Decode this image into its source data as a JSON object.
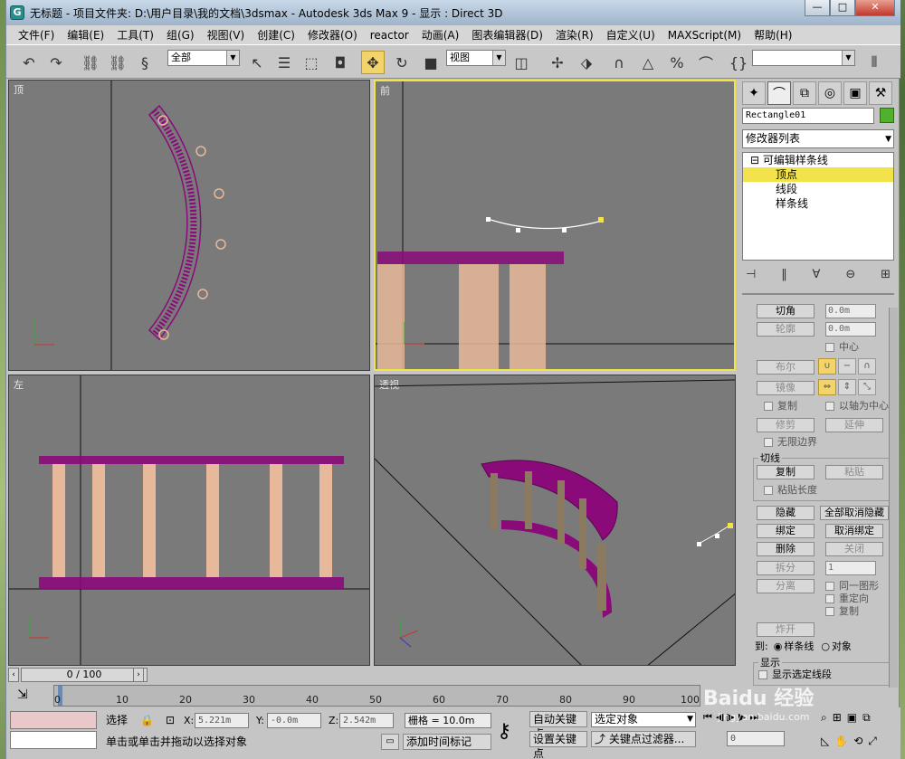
{
  "window": {
    "icon_label": "G",
    "title": "无标题    - 项目文件夹: D:\\用户目录\\我的文档\\3dsmax      - Autodesk 3ds Max 9      - 显示 : Direct 3D",
    "controls": [
      "—",
      "□",
      "✕"
    ]
  },
  "menu": [
    "文件(F)",
    "编辑(E)",
    "工具(T)",
    "组(G)",
    "视图(V)",
    "创建(C)",
    "修改器(O)",
    "reactor",
    "动画(A)",
    "图表编辑器(D)",
    "渲染(R)",
    "自定义(U)",
    "MAXScript(M)",
    "帮助(H)"
  ],
  "toolbar": {
    "selection_filter": "全部",
    "reference_coord": "视图",
    "named_selection": ""
  },
  "viewports": {
    "top": "顶",
    "front": "前",
    "left": "左",
    "perspective": "透视"
  },
  "command_panel": {
    "object_name": "Rectangle01",
    "modifier_list": "修改器列表",
    "stack": {
      "base": "可编辑样条线",
      "vertex": "顶点",
      "segment": "线段",
      "spline": "样条线"
    },
    "fillet_label": "切角",
    "fillet_value": "0.0m",
    "outline_label": "轮廓",
    "outline_value": "0.0m",
    "center_label": "中心",
    "boolean_label": "布尔",
    "mirror_label": "镜像",
    "copy_label": "复制",
    "about_pivot_label": "以轴为中心",
    "trim_label": "修剪",
    "extend_label": "延伸",
    "infinite_bounds_label": "无限边界",
    "cut_group_label": "切线",
    "cut_copy_label": "复制",
    "paste_label": "粘贴",
    "paste_length_label": "粘贴长度",
    "hide_label": "隐藏",
    "unhide_all_label": "全部取消隐藏",
    "bind_label": "绑定",
    "unbind_label": "取消绑定",
    "delete_label": "删除",
    "close_label": "关闭",
    "divide_label": "拆分",
    "divide_value": "1",
    "detach_label": "分离",
    "same_shape_label": "同一图形",
    "reorient_label": "重定向",
    "detach_copy_label": "复制",
    "explode_label": "炸开",
    "explode_to_label": "到:",
    "explode_spline_label": "样条线",
    "explode_object_label": "对象",
    "display_group_label": "显示",
    "show_selected_segs_label": "显示选定线段"
  },
  "timeline": {
    "slider": "0 / 100",
    "ticks": [
      "0",
      "10",
      "20",
      "30",
      "40",
      "50",
      "60",
      "70",
      "80",
      "90",
      "100"
    ]
  },
  "status": {
    "selection_label": "选择",
    "x_label": "X:",
    "x_value": "5.221m",
    "y_label": "Y:",
    "y_value": "-0.0m",
    "z_label": "Z:",
    "z_value": "2.542m",
    "grid": "栅格 = 10.0m",
    "prompt": "单击或单击并拖动以选择对象",
    "add_time_tag": "添加时间标记",
    "auto_key": "自动关键点",
    "set_key": "设置关键点",
    "key_mode": "选定对象",
    "key_filters": "关键点过滤器...",
    "frame": "0"
  },
  "watermark": {
    "logo": "Baidu 经验",
    "url": "jingyan.baidu.com"
  },
  "colors": {
    "rail": "#8a0a7a",
    "column": "#e8b89a",
    "active_viewport": "#f2e34a",
    "selected_stack": "#f2e34a"
  }
}
